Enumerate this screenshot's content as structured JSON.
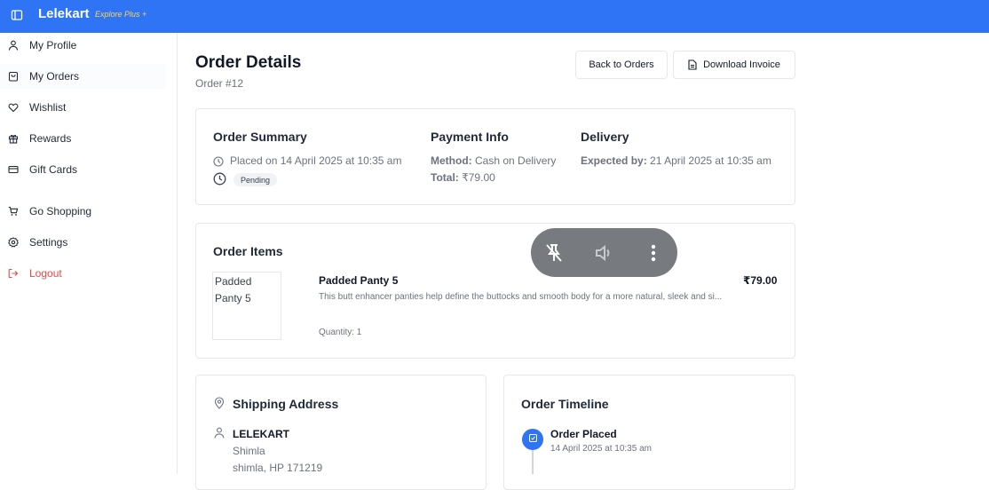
{
  "header": {
    "brand": "Lelekart",
    "brand_tagline": "Explore Plus +",
    "accent": "#2f74f5"
  },
  "sidebar": {
    "items": [
      {
        "label": "My Profile",
        "icon": "user-icon"
      },
      {
        "label": "My Orders",
        "icon": "shopping-bag-icon"
      },
      {
        "label": "Wishlist",
        "icon": "heart-icon"
      },
      {
        "label": "Rewards",
        "icon": "gift-icon"
      },
      {
        "label": "Gift Cards",
        "icon": "credit-card-icon"
      },
      {
        "label": "Go Shopping",
        "icon": "cart-icon"
      },
      {
        "label": "Settings",
        "icon": "gear-icon"
      },
      {
        "label": "Logout",
        "icon": "logout-icon"
      }
    ]
  },
  "page": {
    "title": "Order Details",
    "subtitle": "Order #12",
    "back_label": "Back to Orders",
    "invoice_label": "Download Invoice"
  },
  "summary": {
    "title": "Order Summary",
    "placed": "Placed on 14 April 2025 at 10:35 am",
    "status": "Pending"
  },
  "payment": {
    "title": "Payment Info",
    "method_label": "Method:",
    "method_value": "Cash on Delivery",
    "total_label": "Total:",
    "total_value": "₹79.00"
  },
  "delivery": {
    "title": "Delivery",
    "expected_label": "Expected by:",
    "expected_value": "21 April 2025 at 10:35 am"
  },
  "items": {
    "title": "Order Items",
    "list": [
      {
        "image_alt": "Padded Panty 5",
        "name": "Padded Panty 5",
        "description": "This butt enhancer panties help define the buttocks and smooth body for a more natural, sleek and si...",
        "quantity": "Quantity: 1",
        "price": "₹79.00"
      }
    ]
  },
  "shipping": {
    "title": "Shipping Address",
    "name": "LELEKART",
    "line1": "Shimla",
    "line2": "shimla, HP 171219"
  },
  "timeline": {
    "title": "Order Timeline",
    "events": [
      {
        "label": "Order Placed",
        "time": "14 April 2025 at 10:35 am"
      }
    ]
  },
  "media_overlay": {
    "icons": [
      "pin-off-icon",
      "volume-icon",
      "more-vertical-icon"
    ]
  }
}
